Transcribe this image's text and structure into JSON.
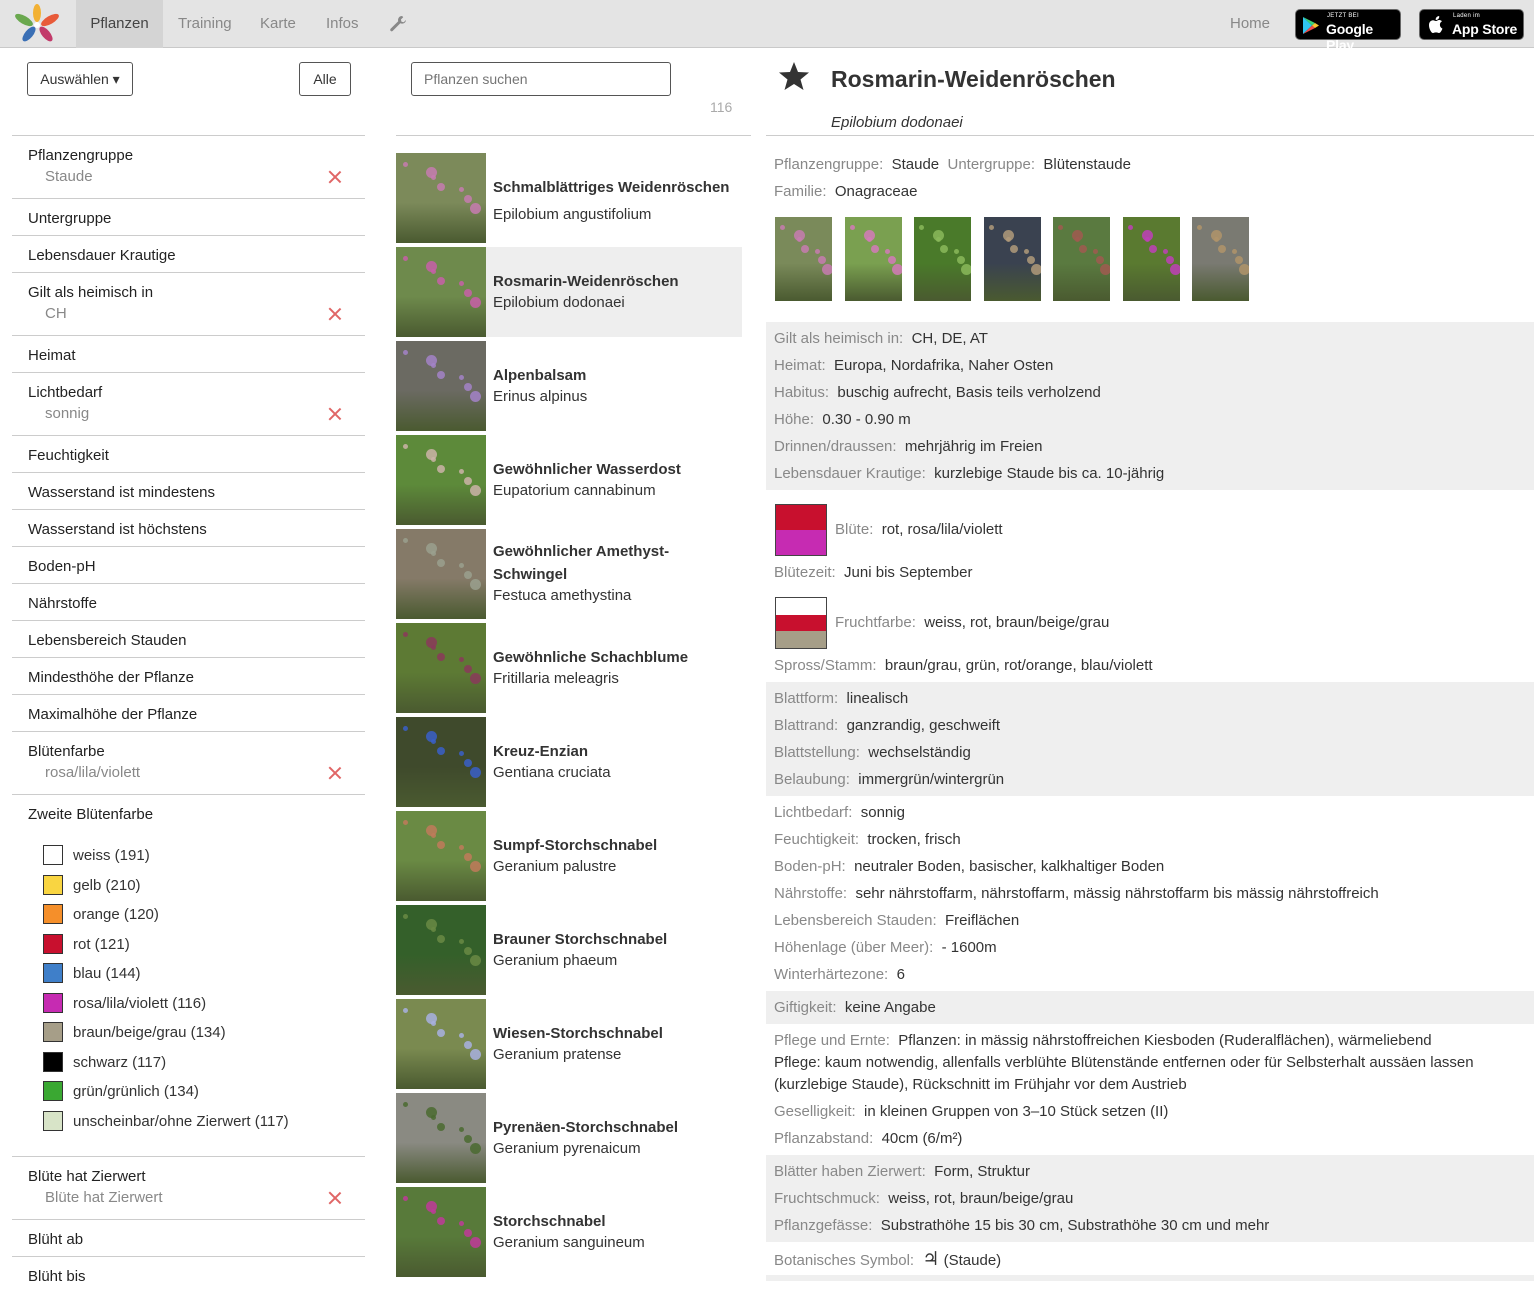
{
  "nav": {
    "items": [
      "Pflanzen",
      "Training",
      "Karte",
      "Infos"
    ],
    "home": "Home",
    "google_small": "JETZT BEI",
    "google_big": "Google Play",
    "apple_small": "Laden im",
    "apple_big": "App Store"
  },
  "left": {
    "select_label": "Auswählen ▾",
    "all_label": "Alle",
    "filters": [
      {
        "label": "Pflanzengruppe",
        "value": "Staude"
      },
      {
        "label": "Untergruppe",
        "value": ""
      },
      {
        "label": "Lebensdauer Krautige",
        "value": ""
      },
      {
        "label": "Gilt als heimisch in",
        "value": "CH"
      },
      {
        "label": "Heimat",
        "value": ""
      },
      {
        "label": "Lichtbedarf",
        "value": "sonnig"
      },
      {
        "label": "Feuchtigkeit",
        "value": ""
      },
      {
        "label": "Wasserstand ist mindestens",
        "value": ""
      },
      {
        "label": "Wasserstand ist höchstens",
        "value": ""
      },
      {
        "label": "Boden-pH",
        "value": ""
      },
      {
        "label": "Nährstoffe",
        "value": ""
      },
      {
        "label": "Lebensbereich Stauden",
        "value": ""
      },
      {
        "label": "Mindesthöhe der Pflanze",
        "value": ""
      },
      {
        "label": "Maximalhöhe der Pflanze",
        "value": ""
      },
      {
        "label": "Blütenfarbe",
        "value": "rosa/lila/violett"
      },
      {
        "label": "Zweite Blütenfarbe",
        "value": ""
      },
      {
        "label": "Blüte hat Zierwert",
        "value": "Blüte hat Zierwert"
      },
      {
        "label": "Blüht ab",
        "value": ""
      },
      {
        "label": "Blüht bis",
        "value": ""
      }
    ],
    "colors": [
      {
        "label": "weiss (191)",
        "color": "#ffffff"
      },
      {
        "label": "gelb (210)",
        "color": "#f9d541"
      },
      {
        "label": "orange (120)",
        "color": "#f58f2a"
      },
      {
        "label": "rot (121)",
        "color": "#c8102e"
      },
      {
        "label": "blau (144)",
        "color": "#3f7fc9"
      },
      {
        "label": "rosa/lila/violett (116)",
        "color": "#c62bb2"
      },
      {
        "label": "braun/beige/grau (134)",
        "color": "#a69e88"
      },
      {
        "label": "schwarz (117)",
        "color": "#000000"
      },
      {
        "label": "grün/grünlich (134)",
        "color": "#3aa832"
      },
      {
        "label": "unscheinbar/ohne Zierwert (117)",
        "color": "#d8e4c8"
      }
    ]
  },
  "mid": {
    "search_placeholder": "Pflanzen suchen",
    "count": "116",
    "plants": [
      {
        "name": "Schmalblättriges Weidenröschen",
        "latin": "Epilobium angustifolium",
        "bg": "#7c8a5a",
        "accent": "#c77bb0"
      },
      {
        "name": "Rosmarin-Weidenröschen",
        "latin": "Epilobium dodonaei",
        "bg": "#6e8a4c",
        "accent": "#c85fa8"
      },
      {
        "name": "Alpenbalsam",
        "latin": "Erinus alpinus",
        "bg": "#6b6a62",
        "accent": "#a383c8"
      },
      {
        "name": "Gewöhnlicher Wasserdost",
        "latin": "Eupatorium cannabinum",
        "bg": "#5d8a3a",
        "accent": "#cbb3a8"
      },
      {
        "name": "Gewöhnlicher Amethyst-Schwingel",
        "latin": "Festuca amethystina",
        "bg": "#857a68",
        "accent": "#9aa08e"
      },
      {
        "name": "Gewöhnliche Schachblume",
        "latin": "Fritillaria meleagris",
        "bg": "#5d7a34",
        "accent": "#8a3a5a"
      },
      {
        "name": "Kreuz-Enzian",
        "latin": "Gentiana cruciata",
        "bg": "#3f4a2c",
        "accent": "#3a5fc8"
      },
      {
        "name": "Sumpf-Storchschnabel",
        "latin": "Geranium palustre",
        "bg": "#6a8a44",
        "accent": "#c07a5a"
      },
      {
        "name": "Brauner Storchschnabel",
        "latin": "Geranium phaeum",
        "bg": "#34602a",
        "accent": "#6a8a44"
      },
      {
        "name": "Wiesen-Storchschnabel",
        "latin": "Geranium pratense",
        "bg": "#7a8a50",
        "accent": "#a8b0e0"
      },
      {
        "name": "Pyrenäen-Storchschnabel",
        "latin": "Geranium pyrenaicum",
        "bg": "#8a8a82",
        "accent": "#4a6a30"
      },
      {
        "name": "Storchschnabel",
        "latin": "Geranium sanguineum",
        "bg": "#587a3a",
        "accent": "#c03a9a"
      }
    ]
  },
  "detail": {
    "title": "Rosmarin-Weidenröschen",
    "latin": "Epilobium dodonaei",
    "group": {
      "k1": "Pflanzengruppe:",
      "v1": "Staude",
      "k2": "Untergruppe:",
      "v2": "Blütenstaude"
    },
    "familie": {
      "k": "Familie:",
      "v": "Onagraceae"
    },
    "photos": [
      {
        "bg": "#7a8a5a",
        "accent": "#c77bb0"
      },
      {
        "bg": "#7aa050",
        "accent": "#d47ab8"
      },
      {
        "bg": "#4a7a2a",
        "accent": "#8ab85a"
      },
      {
        "bg": "#3a4250",
        "accent": "#b09a7a"
      },
      {
        "bg": "#5a7a40",
        "accent": "#a05a50"
      },
      {
        "bg": "#5a7a30",
        "accent": "#c040b8"
      },
      {
        "bg": "#7a7a72",
        "accent": "#b0946a"
      }
    ],
    "band1": [
      {
        "k": "Gilt als heimisch in:",
        "v": "CH, DE, AT"
      },
      {
        "k": "Heimat:",
        "v": "Europa, Nordafrika, Naher Osten"
      },
      {
        "k": "Habitus:",
        "v": "buschig aufrecht, Basis teils verholzend"
      },
      {
        "k": "Höhe:",
        "v": "0.30 - 0.90 m"
      },
      {
        "k": "Drinnen/draussen:",
        "v": "mehrjährig im Freien"
      },
      {
        "k": "Lebensdauer Krautige:",
        "v": "kurzlebige Staude bis ca. 10-jährig"
      }
    ],
    "bluete": {
      "k": "Blüte:",
      "v": "rot, rosa/lila/violett",
      "colors": [
        "#c8102e",
        "#c62bb2"
      ]
    },
    "bluetezeit": {
      "k": "Blütezeit:",
      "v": "Juni bis September"
    },
    "frucht": {
      "k": "Fruchtfarbe:",
      "v": "weiss, rot, braun/beige/grau",
      "colors": [
        "#ffffff",
        "#c8102e",
        "#a69e88"
      ]
    },
    "spross": {
      "k": "Spross/Stamm:",
      "v": "braun/grau, grün, rot/orange, blau/violett"
    },
    "band2": [
      {
        "k": "Blattform:",
        "v": "linealisch"
      },
      {
        "k": "Blattrand:",
        "v": "ganzrandig, geschweift"
      },
      {
        "k": "Blattstellung:",
        "v": "wechselständig"
      },
      {
        "k": "Belaubung:",
        "v": "immergrün/wintergrün"
      }
    ],
    "plain1": [
      {
        "k": "Lichtbedarf:",
        "v": "sonnig"
      },
      {
        "k": "Feuchtigkeit:",
        "v": "trocken, frisch"
      },
      {
        "k": "Boden-pH:",
        "v": "neutraler Boden, basischer, kalkhaltiger Boden"
      },
      {
        "k": "Nährstoffe:",
        "v": "sehr nährstoffarm, nährstoffarm, mässig nährstoffarm bis mässig nährstoffreich"
      },
      {
        "k": "Lebensbereich Stauden:",
        "v": "Freiflächen"
      },
      {
        "k": "Höhenlage (über Meer):",
        "v": "-  1600m"
      },
      {
        "k": "Winterhärtezone:",
        "v": "6"
      }
    ],
    "gift": {
      "k": "Giftigkeit:",
      "v": "keine Angabe"
    },
    "pflege": {
      "k": "Pflege und Ernte:",
      "v1": "Pflanzen: in mässig nährstoffreichen Kiesboden (Ruderalflächen), wärmeliebend",
      "v2": "Pflege: kaum notwendig, allenfalls verblühte Blütenstände entfernen oder für Selbsterhalt aussäen lassen (kurzlebige Staude), Rückschnitt im Frühjahr vor dem Austrieb"
    },
    "gesellig": {
      "k": "Geselligkeit:",
      "v": "in kleinen Gruppen von 3–10 Stück setzen (II)"
    },
    "abstand": {
      "k": "Pflanzabstand:",
      "v": "40cm (6/m²)"
    },
    "band3": [
      {
        "k": "Blätter haben Zierwert:",
        "v": "Form, Struktur"
      },
      {
        "k": "Fruchtschmuck:",
        "v": "weiss, rot, braun/beige/grau"
      },
      {
        "k": "Pflanzgefässe:",
        "v": "Substrathöhe 15 bis 30 cm, Substrathöhe 30 cm und mehr"
      }
    ],
    "symbol": {
      "k": "Botanisches Symbol:",
      "glyph": "♃",
      "v": "(Staude)"
    }
  }
}
